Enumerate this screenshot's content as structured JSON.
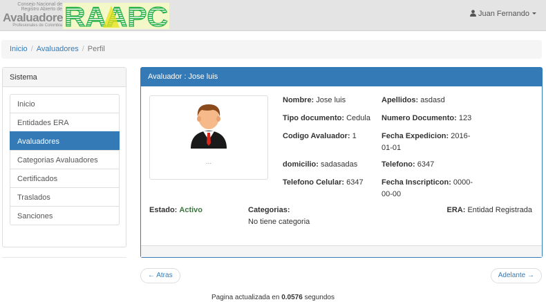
{
  "header": {
    "logo_small_line1": "Consejo Nacional de",
    "logo_small_line2": "Registro Abierto de",
    "logo_small_line3": "Avaluadores",
    "logo_small_line4": "Profesionales de Colombia",
    "logo_big": "RAAPC",
    "user_name": "Juan Fernando"
  },
  "breadcrumb": [
    "Inicio",
    "Avaluadores",
    "Perfil"
  ],
  "sidebar": {
    "title": "Sistema",
    "items": [
      {
        "label": "Inicio",
        "active": false
      },
      {
        "label": "Entidades ERA",
        "active": false
      },
      {
        "label": "Avaluadores",
        "active": true
      },
      {
        "label": "Categorias Avaluadores",
        "active": false
      },
      {
        "label": "Certificados",
        "active": false
      },
      {
        "label": "Traslados",
        "active": false
      },
      {
        "label": "Sanciones",
        "active": false
      }
    ]
  },
  "profile": {
    "panel_title": "Avaluador : Jose luis",
    "photo_caption": "...",
    "nombre_label": "Nombre:",
    "nombre": "Jose luis",
    "apellidos_label": "Apellidos:",
    "apellidos": "asdasd",
    "tipo_doc_label": "Tipo documento:",
    "tipo_doc": "Cedula",
    "num_doc_label": "Numero Documento:",
    "num_doc": "123",
    "codigo_label": "Codigo Avaluador:",
    "codigo": "1",
    "fecha_exp_label": "Fecha Expedicion:",
    "fecha_exp_line1": "2016-",
    "fecha_exp_line2": "01-01",
    "domicilio_label": "domicilio:",
    "domicilio": "sadasadas",
    "telefono_label": "Telefono:",
    "telefono": "6347",
    "celular_label": "Telefono Celular:",
    "celular": "6347",
    "fecha_ins_label": "Fecha Inscripticon:",
    "fecha_ins_line1": "0000-",
    "fecha_ins_line2": "00-00",
    "estado_label": "Estado:",
    "estado": "Activo",
    "categorias_label": "Categorias:",
    "categorias": "No tiene categoria",
    "era_label": "ERA:",
    "era": "Entidad Registrada"
  },
  "pager": {
    "prev": "← Atras",
    "next": "Adelante →"
  },
  "footer": {
    "timing_prefix": "Pagina actualizada en",
    "timing_value": "0.0576",
    "timing_suffix": "segundos"
  },
  "colors": {
    "primary": "#337ab7",
    "success": "#3c763d",
    "logo_green": "#2db34a",
    "logo_yellow": "#e8e21b"
  }
}
